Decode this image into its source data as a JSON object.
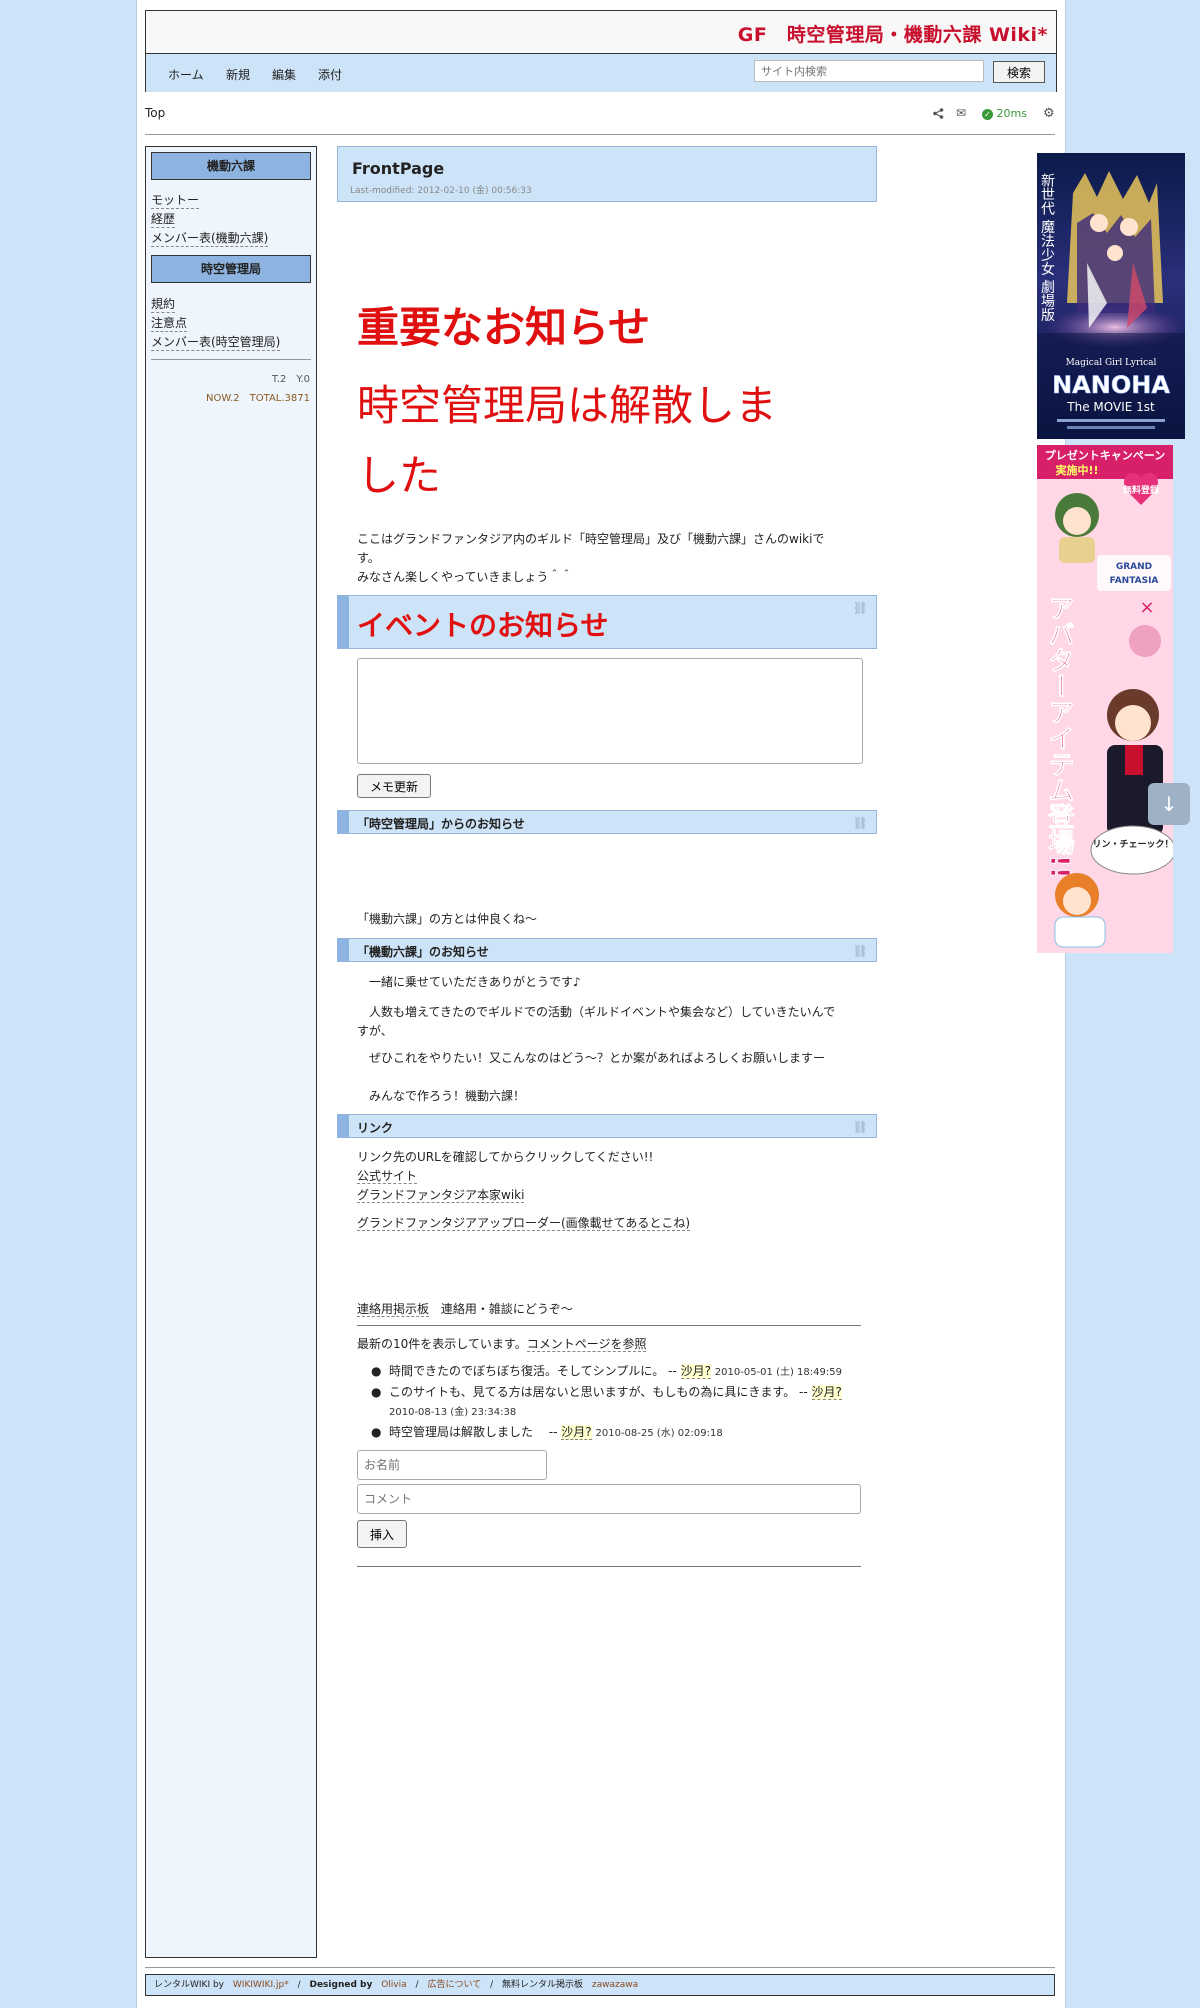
{
  "header": {
    "site_title": "GF　時空管理局・機動六課 Wiki*",
    "nav": [
      "ホーム",
      "新規",
      "編集",
      "添付"
    ],
    "search_placeholder": "サイト内検索",
    "search_button": "検索"
  },
  "topbar": {
    "breadcrumb": "Top",
    "response_time": "20ms"
  },
  "sidebar": {
    "section1_title": "機動六課",
    "section1_links": [
      "モットー",
      "経歴",
      "メンバー表(機動六課)"
    ],
    "section2_title": "時空管理局",
    "section2_links": [
      "規約",
      "注意点",
      "メンバー表(時空管理局)"
    ],
    "counter_line1": "T.2　Y.0",
    "counter_line2": "NOW.2　TOTAL.3871"
  },
  "main": {
    "page_title": "FrontPage",
    "last_modified": "Last-modified: 2012-02-10 (金) 00:56:33",
    "notice_heading": "重要なお知らせ",
    "notice_line1": "時空管理局は解散しま",
    "notice_line2": "した",
    "intro_line1": "ここはグランドファンタジア内のギルド「時空管理局」及び「機動六課」さんのwikiです。",
    "intro_line2": "みなさん楽しくやっていきましょう＾＾",
    "event_heading": "イベントのお知らせ",
    "memo_button": "メモ更新",
    "jikuu_heading": "「時空管理局」からのお知らせ",
    "jikuu_text": "「機動六課」の方とは仲良くね〜",
    "kidou_heading": "「機動六課」のお知らせ",
    "kidou_lines": [
      "一緒に乗せていただきありがとうです♪",
      "人数も増えてきたのでギルドでの活動（ギルドイベントや集会など）していきたいんですが、",
      "ぜひこれをやりたい！又こんなのはどう〜？とか案があればよろしくお願いしますー",
      "みんなで作ろう！機動六課！"
    ],
    "link_heading": "リンク",
    "link_note": "リンク先のURLを確認してからクリックしてください!!",
    "links": [
      "公式サイト",
      "グランドファンタジア本家wiki",
      "グランドファンタジアアップローダー(画像載せてあるとこね)"
    ],
    "board_link": "連絡用掲示板",
    "board_desc": "連絡用・雑談にどうぞ〜",
    "recent_prefix": "最新の10件を表示しています。",
    "recent_link": "コメントページを参照",
    "comments": [
      {
        "text": "時間できたのでぼちぼち復活。そしてシンプルに。 -- ",
        "author": "沙月?",
        "date": "2010-05-01 (土) 18:49:59"
      },
      {
        "text": "このサイトも、見てる方は居ないと思いますが、もしもの為に具にきます。 -- ",
        "author": "沙月?",
        "date": "2010-08-13 (金) 23:34:38"
      },
      {
        "text": "時空管理局は解散しました　 -- ",
        "author": "沙月?",
        "date": "2010-08-25 (水) 02:09:18"
      }
    ],
    "name_placeholder": "お名前",
    "comment_placeholder": "コメント",
    "insert_button": "挿入"
  },
  "banners": {
    "banner1_vertical": "新世代 魔法少女 劇場版",
    "banner1_sub": "Magical Girl Lyrical",
    "banner1_title": "NANOHA",
    "banner1_movie": "The MOVIE 1st",
    "banner2_top1": "プレゼントキャンペーン",
    "banner2_top2": "実施中!!",
    "banner2_badge": "無料登録",
    "banner2_vertical": "アバターアイテム登場!!",
    "banner2_bubble": "リン・チェーック！"
  },
  "footer": {
    "rental_prefix": "レンタルWIKI by",
    "rental_link": "WIKIWIKI.jp*",
    "designed_prefix": "Designed by",
    "designed_link": "Olivia",
    "ad_link": "広告について",
    "bbs_prefix": "無料レンタル掲示板",
    "bbs_link": "zawazawa"
  },
  "colors": {
    "accent": "#cde3f7",
    "notice_red": "#e01010",
    "title_red": "#c8102e"
  }
}
